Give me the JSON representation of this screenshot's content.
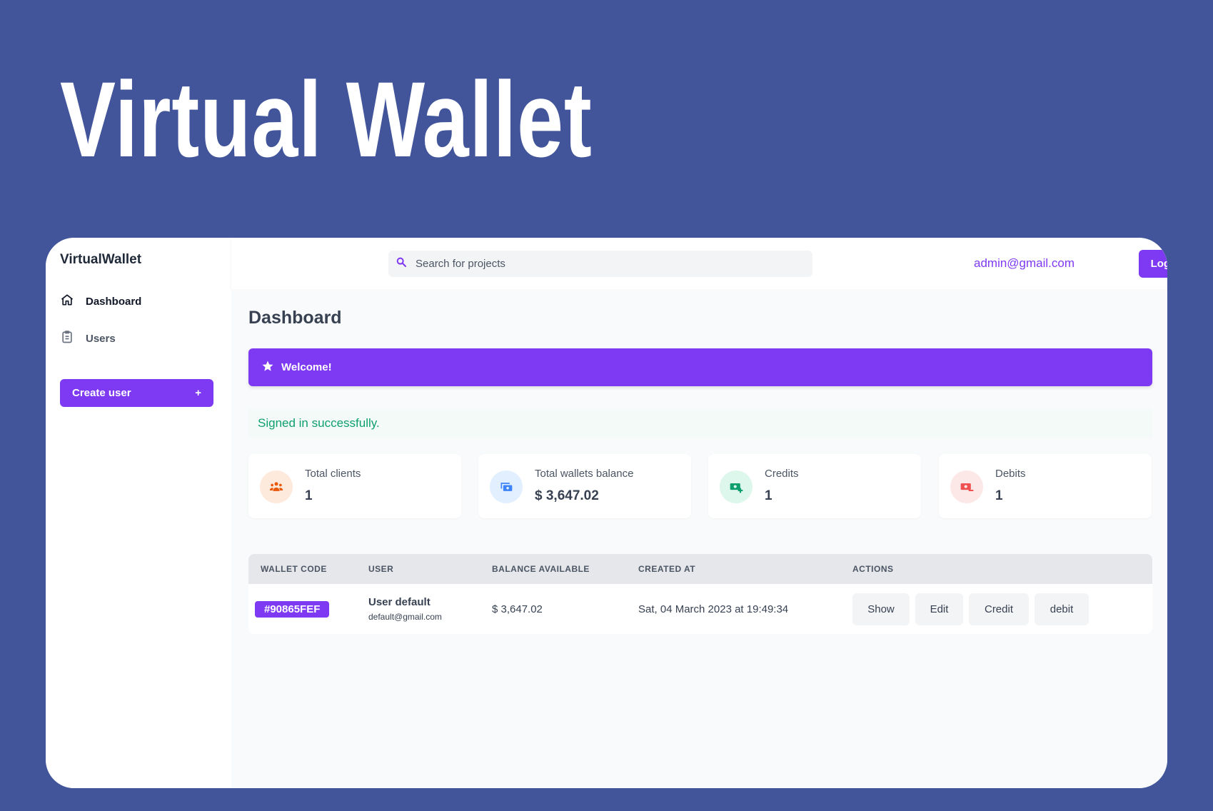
{
  "hero": {
    "title": "Virtual Wallet"
  },
  "app": {
    "brand": "VirtualWallet"
  },
  "sidebar": {
    "items": [
      {
        "label": "Dashboard",
        "icon": "home-icon",
        "active": true
      },
      {
        "label": "Users",
        "icon": "clipboard-icon",
        "active": false
      }
    ],
    "create_button": {
      "label": "Create user",
      "icon_text": "+"
    }
  },
  "topbar": {
    "search_placeholder": "Search for projects",
    "user_email": "admin@gmail.com",
    "logout_label": "Logout"
  },
  "main": {
    "title": "Dashboard",
    "welcome": "Welcome!",
    "notice": "Signed in successfully.",
    "cards": [
      {
        "label": "Total clients",
        "value": "1",
        "icon": "users-icon",
        "color": "#ea580c",
        "bg": "#feeadc"
      },
      {
        "label": "Total wallets balance",
        "value": "$ 3,647.02",
        "icon": "cash-icon",
        "color": "#3f83f8",
        "bg": "#e1effe"
      },
      {
        "label": "Credits",
        "value": "1",
        "icon": "cash-plus-icon",
        "color": "#0e9f6e",
        "bg": "#def7ec"
      },
      {
        "label": "Debits",
        "value": "1",
        "icon": "cash-minus-icon",
        "color": "#f05252",
        "bg": "#fde8e8"
      }
    ],
    "table": {
      "headers": [
        "WALLET CODE",
        "USER",
        "BALANCE AVAILABLE",
        "CREATED AT",
        "ACTIONS"
      ],
      "rows": [
        {
          "code": "#90865FEF",
          "user_name": "User default",
          "user_email": "default@gmail.com",
          "balance": "$ 3,647.02",
          "created_at": "Sat, 04 March 2023 at 19:49:34",
          "actions": [
            "Show",
            "Edit",
            "Credit",
            "debit"
          ]
        }
      ]
    }
  },
  "colors": {
    "accent": "#7e3af2",
    "background": "#42559b",
    "success": "#0e9f6e"
  }
}
